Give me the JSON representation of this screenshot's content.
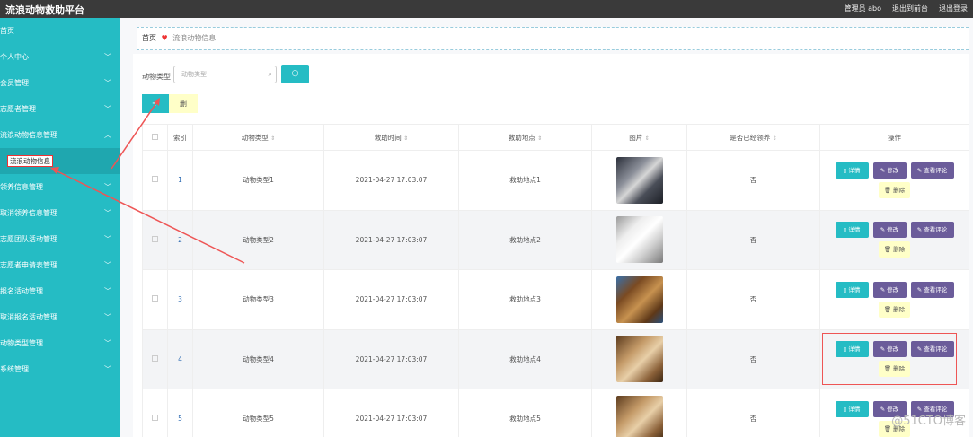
{
  "app": {
    "title": "流浪动物救助平台"
  },
  "topbar": {
    "admin": "管理员 abo",
    "back_to_frontend": "退出到前台",
    "logout": "退出登录"
  },
  "sidebar": {
    "items": [
      {
        "label": "首页",
        "chevron": false
      },
      {
        "label": "个人中心",
        "chevron": true
      },
      {
        "label": "会员管理",
        "chevron": true
      },
      {
        "label": "志愿者管理",
        "chevron": true
      },
      {
        "label": "流浪动物信息管理",
        "chevron": true
      },
      {
        "label": "流浪动物信息",
        "chevron": false,
        "sub": true,
        "active": true
      },
      {
        "label": "领养信息管理",
        "chevron": true
      },
      {
        "label": "取消领养信息管理",
        "chevron": true
      },
      {
        "label": "志愿团队活动管理",
        "chevron": true
      },
      {
        "label": "志愿者申请表管理",
        "chevron": true
      },
      {
        "label": "报名活动管理",
        "chevron": true
      },
      {
        "label": "取消报名活动管理",
        "chevron": true
      },
      {
        "label": "动物类型管理",
        "chevron": true
      },
      {
        "label": "系统管理",
        "chevron": true
      }
    ]
  },
  "breadcrumb": {
    "home": "首页",
    "current": "流浪动物信息"
  },
  "search": {
    "label": "动物类型",
    "placeholder": "动物类型",
    "button": "○"
  },
  "toolbar": {
    "add": "+",
    "delete": "删"
  },
  "table": {
    "headers": [
      "索引",
      "动物类型",
      "救助时间",
      "救助地点",
      "图片",
      "是否已经领养",
      "操作"
    ],
    "rows": [
      {
        "index": "1",
        "type": "动物类型1",
        "time": "2021-04-27 17:03:07",
        "place": "救助地点1",
        "adopted": "否",
        "img": "dark"
      },
      {
        "index": "2",
        "type": "动物类型2",
        "time": "2021-04-27 17:03:07",
        "place": "救助地点2",
        "adopted": "否",
        "img": "white"
      },
      {
        "index": "3",
        "type": "动物类型3",
        "time": "2021-04-27 17:03:07",
        "place": "救助地点3",
        "adopted": "否",
        "img": "brown"
      },
      {
        "index": "4",
        "type": "动物类型4",
        "time": "2021-04-27 17:03:07",
        "place": "救助地点4",
        "adopted": "否",
        "img": "tan"
      },
      {
        "index": "5",
        "type": "动物类型5",
        "time": "2021-04-27 17:03:07",
        "place": "救助地点5",
        "adopted": "否",
        "img": "tan"
      }
    ],
    "actions": {
      "detail": "详情",
      "edit": "修改",
      "comment": "查看评论",
      "delete": "删除"
    }
  },
  "watermark": "@51CTO博客",
  "colors": {
    "accent": "#25bcc4",
    "purple": "#6b5c9a",
    "topbar": "#3a3a3a",
    "annotation": "#e55"
  }
}
